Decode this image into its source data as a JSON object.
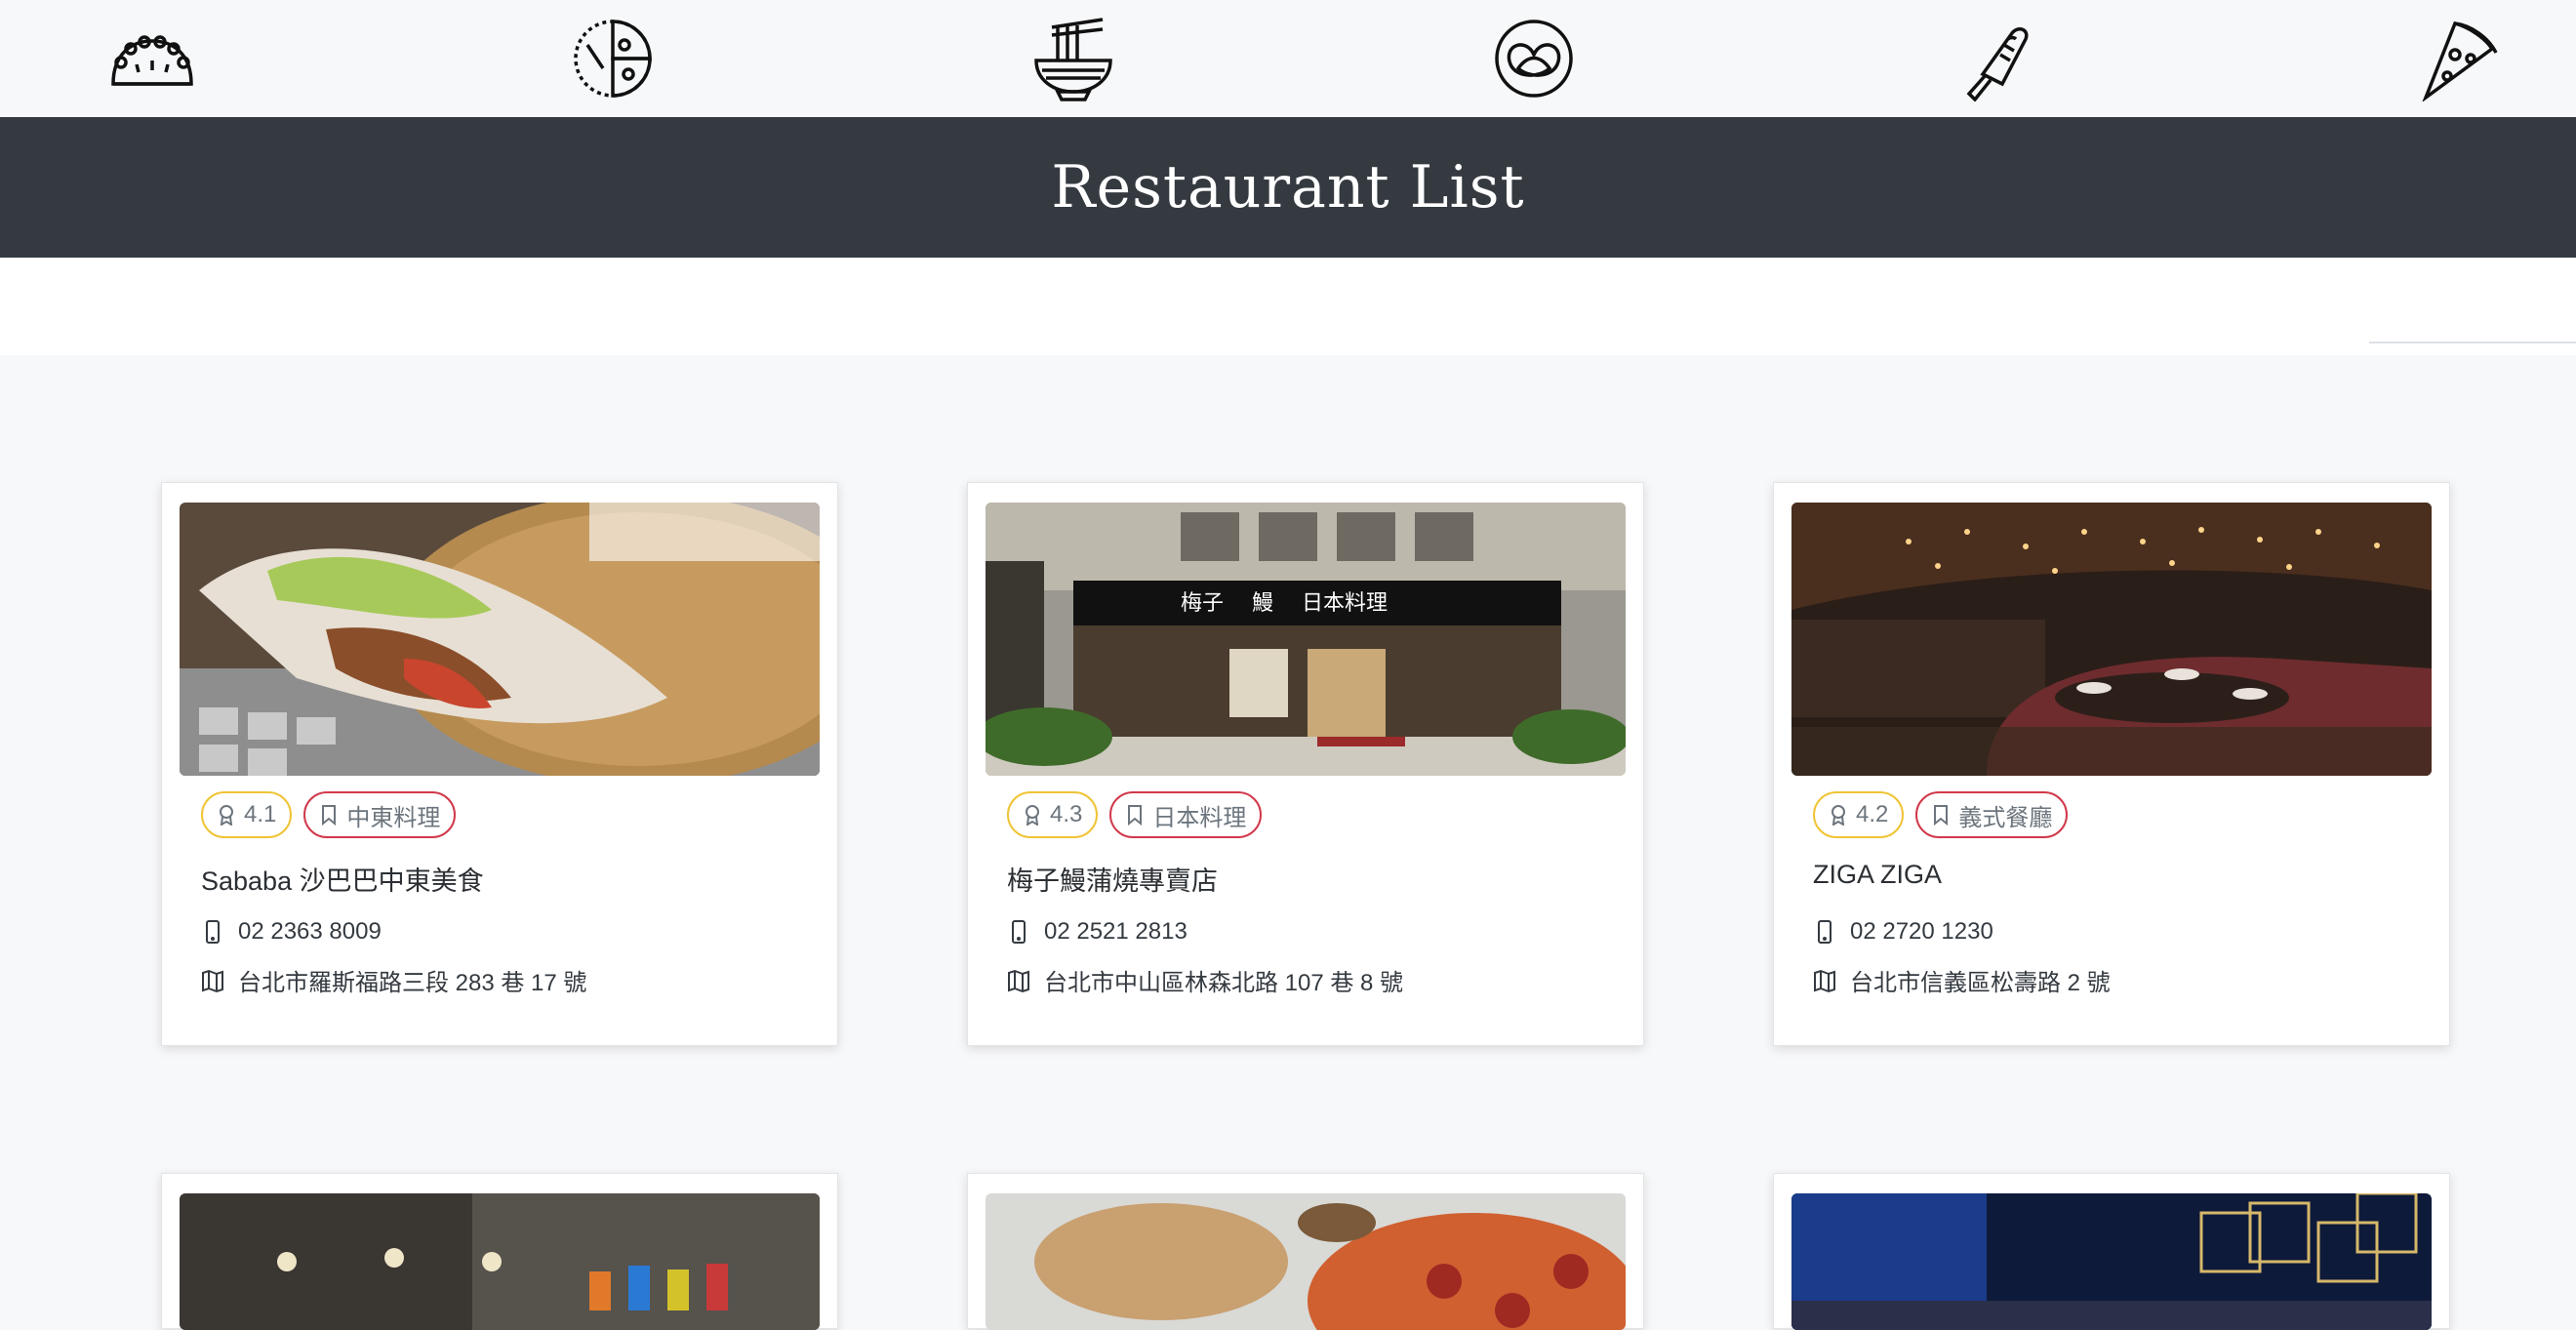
{
  "header": {
    "title": "Restaurant List",
    "icons": [
      "empanada-icon",
      "pizza-slice-round-icon",
      "noodle-bowl-icon",
      "pretzel-icon",
      "popsicle-icon",
      "pizza-slice-icon"
    ]
  },
  "colors": {
    "banner": "#343a40",
    "rating_border": "#f0c436",
    "category_border": "#d1394b"
  },
  "restaurants": [
    {
      "rating": "4.1",
      "category": "中東料理",
      "name": "Sababa 沙巴巴中東美食",
      "phone": "02 2363 8009",
      "address": "台北市羅斯福路三段 283 巷 17 號"
    },
    {
      "rating": "4.3",
      "category": "日本料理",
      "name": "梅子鰻蒲燒專賣店",
      "phone": "02 2521 2813",
      "address": "台北市中山區林森北路 107 巷 8 號"
    },
    {
      "rating": "4.2",
      "category": "義式餐廳",
      "name": "ZIGA ZIGA",
      "phone": "02 2720 1230",
      "address": "台北市信義區松壽路 2 號"
    }
  ]
}
